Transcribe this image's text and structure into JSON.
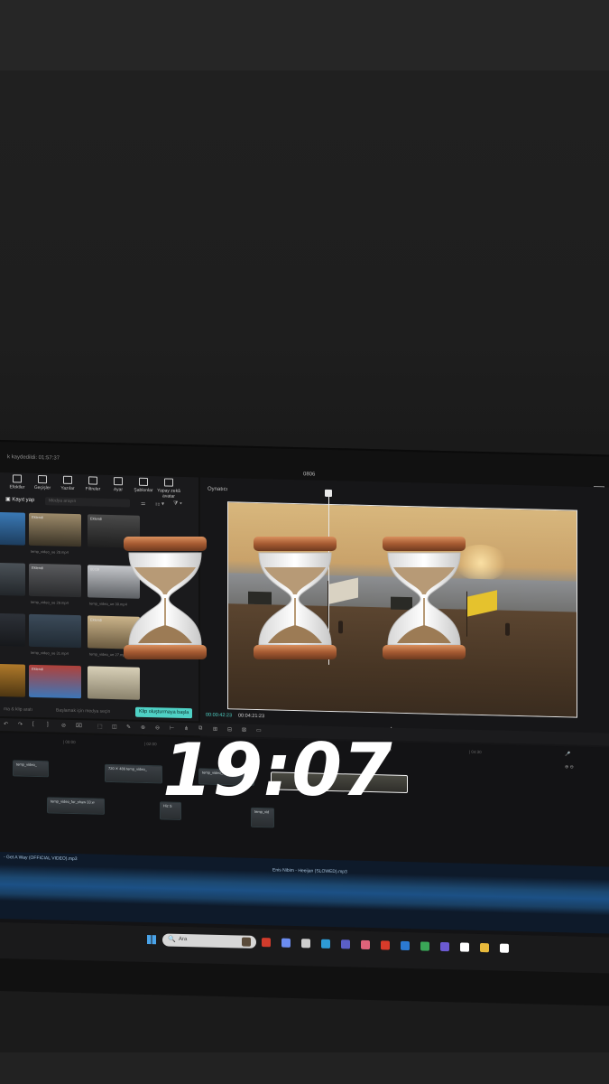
{
  "app": {
    "title": "k kaydedildi: 01:57:37",
    "center_label": "0806"
  },
  "media_panel": {
    "tabs": [
      {
        "label": "Efektler"
      },
      {
        "label": "Geçişler"
      },
      {
        "label": "Yazılar"
      },
      {
        "label": "Filtreler"
      },
      {
        "label": "Ayar"
      },
      {
        "label": "Şablonlar"
      },
      {
        "label": "Yapay zekâ avatar"
      }
    ],
    "record_label": "Kayıt yap",
    "search_placeholder": "Medya arayın",
    "grid_controls": [
      "⚌",
      "⚏ ▾",
      "⧩ ▾"
    ],
    "thumbs": [
      {
        "tag": "00:15",
        "label": "",
        "color_top": "#3a79b5",
        "color_bottom": "#1d3d5e"
      },
      {
        "tag": "Eklendi",
        "label": "temp_video_ue 28.mp4",
        "color_top": "#9c8a6a",
        "color_bottom": "#3a3326"
      },
      {
        "tag": "Eklendi",
        "label": "",
        "color_top": "#4a4a4a",
        "color_bottom": "#1f1f1f"
      },
      {
        "tag": "",
        "label": "temp_video",
        "color_top": "#4b5258",
        "color_bottom": "#22262a"
      },
      {
        "tag": "Eklendi",
        "label": "temp_video_ue 29.mp4",
        "color_top": "#5a5b5e",
        "color_bottom": "#2a2b2d"
      },
      {
        "tag": "00:09",
        "label": "temp_video_ue 30.mp4",
        "color_top": "#c5c7cb",
        "color_bottom": "#5c5f63"
      },
      {
        "tag": "",
        "label": "temp_video",
        "color_top": "#2d3138",
        "color_bottom": "#16181b"
      },
      {
        "tag": "",
        "label": "temp_video_ue 31.mp4",
        "color_top": "#3c4b5a",
        "color_bottom": "#202a33"
      },
      {
        "tag": "Eklendi",
        "label": "temp_video_ue 27.mp4",
        "color_top": "#cbb48a",
        "color_bottom": "#6a5a40"
      },
      {
        "tag": "",
        "label": "",
        "color_top": "#b07a2a",
        "color_bottom": "#4d3612"
      },
      {
        "tag": "Eklendi",
        "label": "",
        "color_top": "#b0413a",
        "color_bottom": "#3c76b8"
      },
      {
        "tag": "",
        "label": "",
        "color_top": "#d8d0b8",
        "color_bottom": "#8a826c"
      }
    ],
    "hint_left": "ma & klip aratı",
    "hint": "Başlamak için medya seçin",
    "cliplink_label": "Klip oluşturmaya başla"
  },
  "player": {
    "title": "Oynatıcı",
    "time_current": "00:00:42:23",
    "time_total": "00:04:21:23",
    "tools": "▭ ⊡ ⤢ ⤡"
  },
  "toolbar": {
    "icons": [
      "↶",
      "↷",
      "[",
      "]",
      "⊘",
      "⌧",
      "⬚",
      "◫",
      "✎",
      "⊕",
      "⊖",
      "⊢",
      "⋔",
      "⧉",
      "⊞",
      "⊟",
      "⊠",
      "▭"
    ]
  },
  "timeline": {
    "ruler": [
      "| 00:00",
      "| 02:00",
      "| 04:00",
      "| 04:30"
    ],
    "clips": [
      {
        "label": "temp_video_",
        "row": 1
      },
      {
        "label": "720 ✕ 486  temp_video_",
        "row": 1
      },
      {
        "label": "temp_video_",
        "row": 1
      },
      {
        "label": "",
        "row": 1
      },
      {
        "label": "temp_video_for_shaw 33.w",
        "row": 2
      },
      {
        "label": "Hiz S",
        "row": 2
      },
      {
        "label": "temp_vid",
        "row": 2
      }
    ],
    "track_controls": [
      "🎤",
      "⊕ ⊖"
    ],
    "audio_labels": [
      "- Get A Way (OFFICIAL VIDEO).mp3",
      "Enis Nibim - Heeijan (SLOWED).mp3"
    ]
  },
  "taskbar": {
    "search_icon": "🔍",
    "search_placeholder": "Ara",
    "icons": [
      {
        "name": "rabbit-icon",
        "color": "#5a4b3a"
      },
      {
        "name": "app-red-icon",
        "color": "#d23c2c"
      },
      {
        "name": "copilot-icon",
        "color": "#6b8cf0"
      },
      {
        "name": "window-icon",
        "color": "#cfcfcf"
      },
      {
        "name": "edge-icon",
        "color": "#2e9bd6"
      },
      {
        "name": "teams-icon",
        "color": "#5b5fc7"
      },
      {
        "name": "photos-icon",
        "color": "#e0637a"
      },
      {
        "name": "acrobat-icon",
        "color": "#d83b2a"
      },
      {
        "name": "photoshop-icon",
        "color": "#2b79d1"
      },
      {
        "name": "chrome-icon",
        "color": "#3aa757"
      },
      {
        "name": "premiere-icon",
        "color": "#6b5ad1"
      },
      {
        "name": "capcut-icon",
        "color": "#ffffff"
      },
      {
        "name": "folder-icon",
        "color": "#e7b93c"
      },
      {
        "name": "capcut2-icon",
        "color": "#ffffff"
      }
    ]
  },
  "overlay": {
    "clock": "19:07",
    "sticker_icon": "hourglass-icon"
  }
}
